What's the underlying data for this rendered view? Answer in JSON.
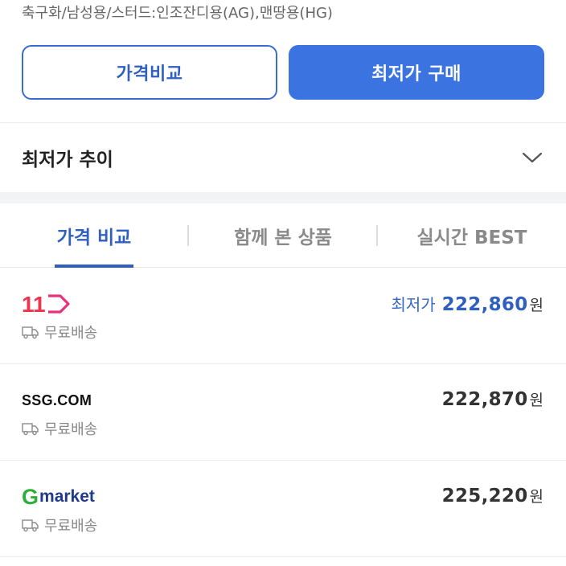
{
  "product": {
    "subtitle": "축구화/남성용/스터드:인조잔디용(AG),맨땅용(HG)"
  },
  "actions": {
    "compare_label": "가격비교",
    "buy_label": "최저가 구매"
  },
  "trend": {
    "title": "최저가 추이"
  },
  "tabs": [
    {
      "label": "가격 비교",
      "active": true
    },
    {
      "label": "함께 본 상품",
      "active": false
    },
    {
      "label": "실시간 BEST",
      "active": false
    }
  ],
  "shops": [
    {
      "name": "11st",
      "logo_text": "11",
      "shipping": "무료배송",
      "lowest_label": "최저가",
      "price": "222,860",
      "currency": "원"
    },
    {
      "name": "SSG.COM",
      "logo_text": "SSG.COM",
      "shipping": "무료배송",
      "price": "222,870",
      "currency": "원"
    },
    {
      "name": "Gmarket",
      "logo_text_g": "G",
      "logo_text_rest": "market",
      "shipping": "무료배송",
      "price": "225,220",
      "currency": "원"
    }
  ],
  "colors": {
    "accent": "#3b73e0",
    "accent_text": "#2f5fbf",
    "eleven_st": "#f0344d",
    "gmarket_green": "#2cae3c",
    "gmarket_blue": "#1f3a8a"
  },
  "icons": {
    "chevron": "chevron-down-icon",
    "truck": "truck-icon"
  }
}
